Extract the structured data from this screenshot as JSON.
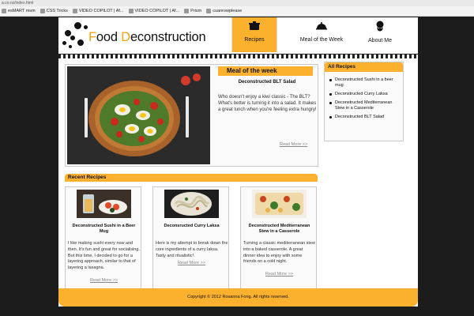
{
  "browser": {
    "url": "a.co.nz/index.html",
    "bookmarks": [
      "esMART msm",
      "CSS Tricks",
      "VIDEO COPILOT | Af...",
      "VIDEO COPILOT | Af...",
      "Prism",
      "cuanrowplease"
    ]
  },
  "site": {
    "logo_text_1": "F",
    "logo_text_2": "ood ",
    "logo_text_3": "D",
    "logo_text_4": "econstruction",
    "nav": [
      {
        "label": "Recipes",
        "icon": "pot-icon"
      },
      {
        "label": "Meal of the Week",
        "icon": "cloche-icon"
      },
      {
        "label": "About Me",
        "icon": "chef-icon"
      }
    ]
  },
  "meal": {
    "heading": "Meal of the week",
    "subtitle": "Deconstructed BLT Salad",
    "description": "Who doesn't enjoy a kiwi classic - The BLT? What's better is turning it into a salad. It makes a great lunch when you're feeling extra hungry!",
    "read_more": "Read More >>"
  },
  "recent": {
    "heading": "Recent Recipes",
    "cards": [
      {
        "title": "Deconstructed Sushi in a Beer Mug",
        "description": "I like making sushi every now and then. It's fun and great for socialising. But this time, I decided to go for a layering approach, similar to that of layering a lasagna.",
        "read_more": "Read More >>"
      },
      {
        "title": "Deconsructed Curry Laksa",
        "description": "Here is my attempt to break down the core ingredients of a curry laksa. Tasty and ritualistic!",
        "read_more": "Read More >>"
      },
      {
        "title": "Deconstructed Mediterranean Stew in a Casserole",
        "description": "Turning a classic mediterranean stew into a baked casserole. A great dinner idea to enjoy with some friends on a cold night.",
        "read_more": "Read More >>"
      }
    ]
  },
  "sidebar": {
    "heading": "All Recipes",
    "items": [
      "Deconstructed Sushi in a beer mug",
      "Deconstructed Curry Laksa",
      "Deconstructed Mediterranean Stew in a Casserole",
      "Deconstructed BLT Salad"
    ]
  },
  "footer": {
    "text": "Copyright © 2012 Rosanna Fong. All rights reserved."
  },
  "colors": {
    "accent": "#fbb12e",
    "page_bg": "#1c1c1c"
  }
}
